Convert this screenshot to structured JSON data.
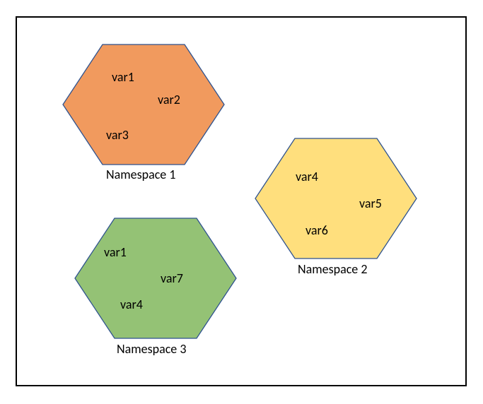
{
  "namespaces": [
    {
      "label": "Namespace 1",
      "fill": "#ED7D31",
      "fillOpacity": 0.78,
      "stroke": "#2E528F",
      "vars": [
        "var1",
        "var2",
        "var3"
      ]
    },
    {
      "label": "Namespace 2",
      "fill": "#FFD966",
      "fillOpacity": 0.85,
      "stroke": "#2E528F",
      "vars": [
        "var4",
        "var5",
        "var6"
      ]
    },
    {
      "label": "Namespace 3",
      "fill": "#70AD47",
      "fillOpacity": 0.75,
      "stroke": "#2E528F",
      "vars": [
        "var1",
        "var7",
        "var4"
      ]
    }
  ]
}
